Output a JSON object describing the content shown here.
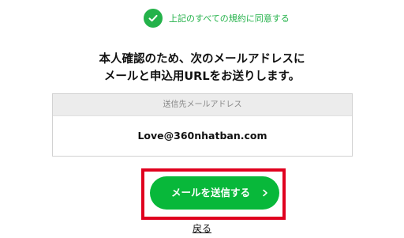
{
  "agreement": {
    "text": "上記のすべての規約に同意する",
    "icon": "check-icon",
    "color": "#24b24a"
  },
  "message": {
    "line1": "本人確認のため、次のメールアドレスに",
    "line2": "メールと申込用URLをお送りします。"
  },
  "email_box": {
    "label": "送信先メールアドレス",
    "value": "Love@360nhatban.com"
  },
  "send_button": {
    "label": "メールを送信する",
    "icon": "chevron-right-icon",
    "color": "#08b83a"
  },
  "highlight": {
    "color": "#e0001f"
  },
  "back_link": {
    "label": "戻る"
  }
}
